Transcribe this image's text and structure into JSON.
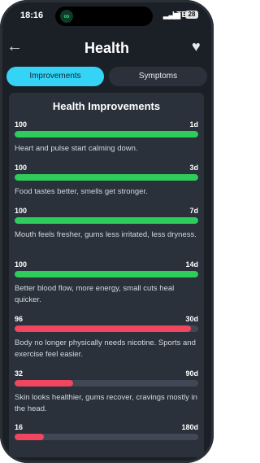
{
  "status": {
    "time": "18:16",
    "network": "LTE",
    "battery": "28"
  },
  "header": {
    "title": "Health"
  },
  "tabs": [
    {
      "label": "Improvements",
      "active": true
    },
    {
      "label": "Symptoms",
      "active": false
    }
  ],
  "card": {
    "title": "Health Improvements",
    "items": [
      {
        "percent": "100",
        "duration": "1d",
        "progress": 100,
        "color": "#2ecc5a",
        "description": "Heart and pulse start calming down."
      },
      {
        "percent": "100",
        "duration": "3d",
        "progress": 100,
        "color": "#2ecc5a",
        "description": "Food tastes better, smells get stronger."
      },
      {
        "percent": "100",
        "duration": "7d",
        "progress": 100,
        "color": "#2ecc5a",
        "description": "Mouth feels fresher, gums less irritated, less dryness."
      },
      {
        "percent": "100",
        "duration": "14d",
        "progress": 100,
        "color": "#2ecc5a",
        "description": "Better blood flow, more energy, small cuts heal quicker."
      },
      {
        "percent": "96",
        "duration": "30d",
        "progress": 96,
        "color": "#f0465f",
        "description": "Body no longer physically needs nicotine. Sports and exercise feel easier."
      },
      {
        "percent": "32",
        "duration": "90d",
        "progress": 32,
        "color": "#f0465f",
        "description": "Skin looks healthier, gums recover, cravings mostly in the head."
      },
      {
        "percent": "16",
        "duration": "180d",
        "progress": 16,
        "color": "#f0465f",
        "description": ""
      }
    ]
  },
  "icons": {
    "back": "arrow-left-icon",
    "favorite": "heart-icon",
    "app": "app-link-icon"
  }
}
